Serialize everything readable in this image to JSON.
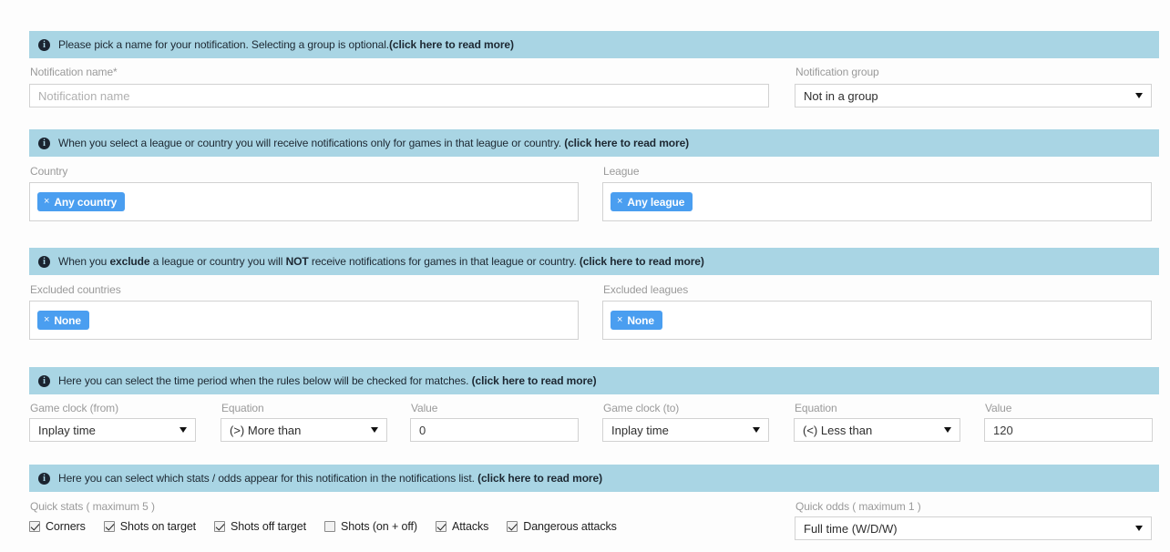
{
  "sections": [
    {
      "info": {
        "icon": "info-circle-icon",
        "parts": [
          {
            "text": "Please pick a name for your notification. Selecting a group is optional.",
            "bold": false
          },
          {
            "text": "(click here to read more)",
            "bold": true
          }
        ]
      }
    },
    {
      "info": {
        "icon": "info-circle-icon",
        "parts": [
          {
            "text": "When you select a league or country you will receive notifications only for games in that league or country. ",
            "bold": false
          },
          {
            "text": "(click here to read more)",
            "bold": true
          }
        ]
      }
    },
    {
      "info": {
        "icon": "info-circle-icon",
        "parts": [
          {
            "text": "When you ",
            "bold": false
          },
          {
            "text": "exclude",
            "bold": true
          },
          {
            "text": " a league or country you will ",
            "bold": false
          },
          {
            "text": "NOT",
            "bold": true
          },
          {
            "text": " receive notifications for games in that league or country. ",
            "bold": false
          },
          {
            "text": "(click here to read more)",
            "bold": true
          }
        ]
      }
    },
    {
      "info": {
        "icon": "info-circle-icon",
        "parts": [
          {
            "text": "Here you can select the time period when the rules below will be checked for matches. ",
            "bold": false
          },
          {
            "text": "(click here to read more)",
            "bold": true
          }
        ]
      }
    },
    {
      "info": {
        "icon": "info-circle-icon",
        "parts": [
          {
            "text": "Here you can select which stats / odds appear for this notification in the notifications list. ",
            "bold": false
          },
          {
            "text": "(click here to read more)",
            "bold": true
          }
        ]
      }
    }
  ],
  "notification_name": {
    "label": "Notification name*",
    "placeholder": "Notification name",
    "value": ""
  },
  "notification_group": {
    "label": "Notification group",
    "value": "Not in a group"
  },
  "country": {
    "label": "Country",
    "tag_close": "×",
    "tag_label": "Any country"
  },
  "league": {
    "label": "League",
    "tag_close": "×",
    "tag_label": "Any league"
  },
  "excluded_countries": {
    "label": "Excluded countries",
    "tag_close": "×",
    "tag_label": "None"
  },
  "excluded_leagues": {
    "label": "Excluded leagues",
    "tag_close": "×",
    "tag_label": "None"
  },
  "clock_from": {
    "label": "Game clock (from)",
    "value": "Inplay time"
  },
  "equation_from": {
    "label": "Equation",
    "value": "(>) More than"
  },
  "value_from": {
    "label": "Value",
    "value": "0"
  },
  "clock_to": {
    "label": "Game clock (to)",
    "value": "Inplay time"
  },
  "equation_to": {
    "label": "Equation",
    "value": "(<) Less than"
  },
  "value_to": {
    "label": "Value",
    "value": "120"
  },
  "quick_stats": {
    "label": "Quick stats ( maximum 5 )",
    "items": [
      {
        "label": "Corners",
        "checked": true
      },
      {
        "label": "Shots on target",
        "checked": true
      },
      {
        "label": "Shots off target",
        "checked": true
      },
      {
        "label": "Shots (on + off)",
        "checked": false
      },
      {
        "label": "Attacks",
        "checked": true
      },
      {
        "label": "Dangerous attacks",
        "checked": true
      }
    ]
  },
  "quick_odds": {
    "label": "Quick odds ( maximum 1 )",
    "value": "Full time (W/D/W)"
  },
  "colors": {
    "info_bar": "#a9d5e4",
    "tag_blue": "#4a9ef0",
    "page_bg": "#fdfdfd",
    "border": "#d2d2d2",
    "label_gray": "#9a9a9a"
  }
}
